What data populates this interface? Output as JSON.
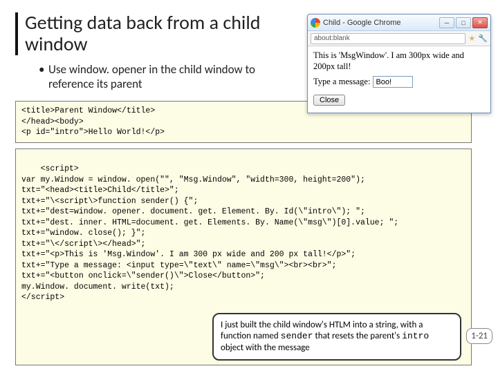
{
  "title": "Getting data back from a child window",
  "bullet": "Use window. opener in the child window to reference its parent",
  "code1": "<title>Parent Window</title>\n</head><body>\n<p id=\"intro\">Hello World!</p>",
  "code2": "<script>\nvar my.Window = window. open(\"\", \"Msg.Window\", \"width=300, height=200\");\ntxt=\"<head><title>Child</title>\";\ntxt+=\"\\<script\\>function sender() {\";\ntxt+=\"dest=window. opener. document. get. Element. By. Id(\\\"intro\\\"); \";\ntxt+=\"dest. inner. HTML=document. get. Elements. By. Name(\\\"msg\\\")[0].value; \";\ntxt+=\"window. close(); }\";\ntxt+=\"\\</script\\></head>\";\ntxt+=\"<p>This is 'Msg.Window'. I am 300 px wide and 200 px tall!</p>\";\ntxt+=\"Type a message: <input type=\\\"text\\\" name=\\\"msg\\\"><br><br>\";\ntxt+=\"<button onclick=\\\"sender()\\\">Close</button>\";\nmy.Window. document. write(txt);\n</script​>",
  "callout": {
    "pre": "I just built the child window's HTLM into a string, with a function named ",
    "fn": "sender",
    "mid": " that resets the parent's ",
    "obj": "intro",
    "post": " object with the message"
  },
  "pagenum": "1-21",
  "childwin": {
    "title": "Child - Google Chrome",
    "url": "about:blank",
    "bodytext": "This is 'MsgWindow'. I am 300px wide and 200px tall!",
    "prompt": "Type a message:",
    "inputval": "Boo!",
    "closebtn": "Close"
  }
}
